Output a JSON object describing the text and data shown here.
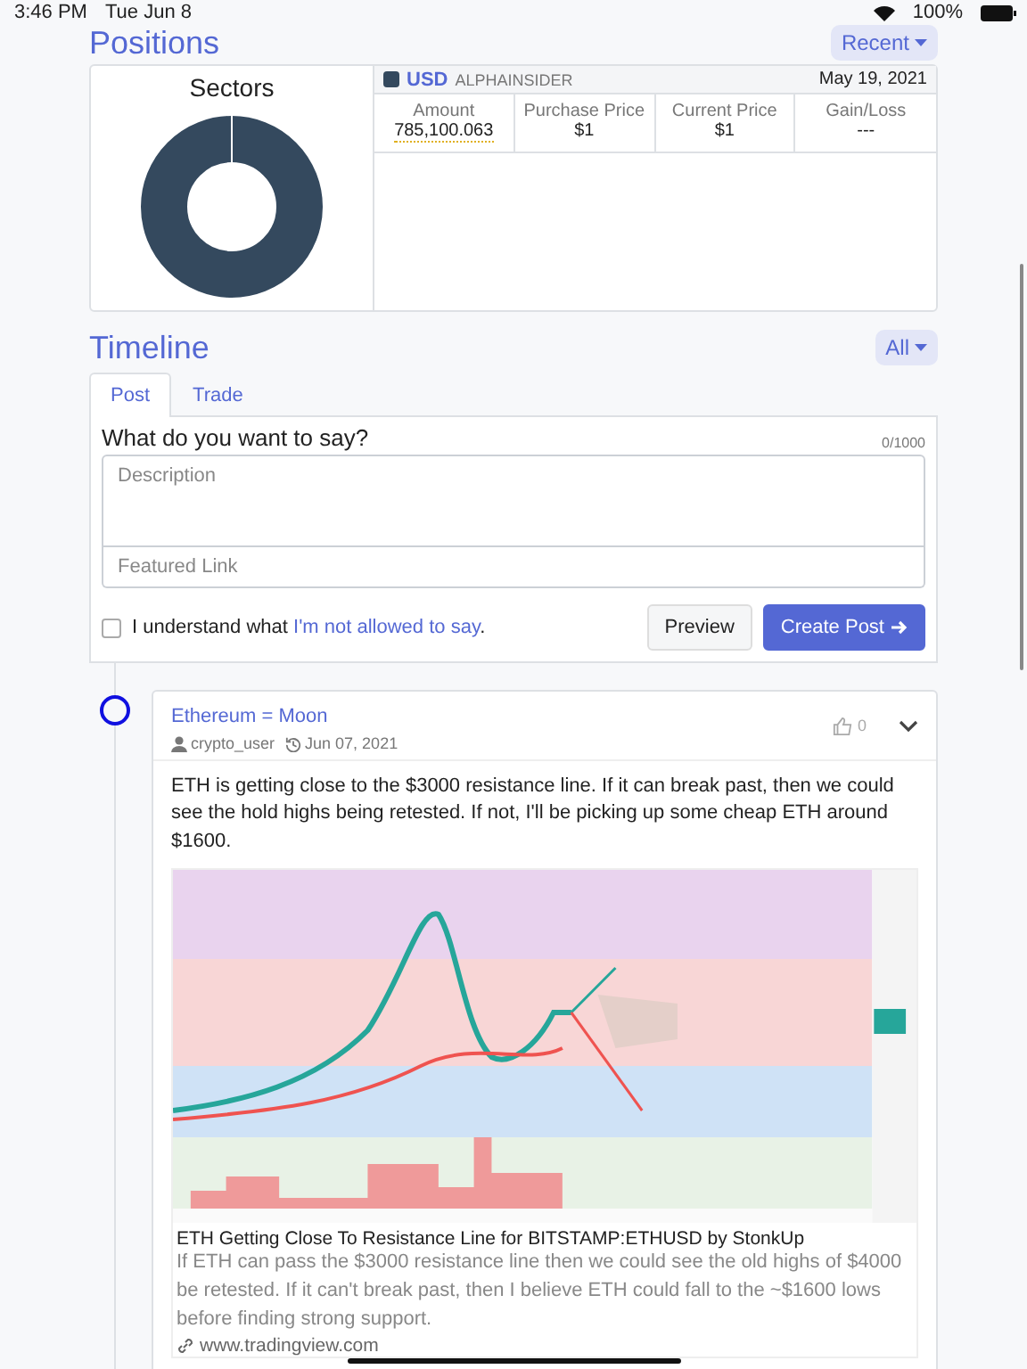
{
  "status_bar": {
    "time": "3:46 PM",
    "date": "Tue Jun 8",
    "battery": "100%"
  },
  "positions": {
    "title": "Positions",
    "filter": "Recent",
    "sectors_title": "Sectors",
    "holding": {
      "symbol": "USD",
      "source": "ALPHAINSIDER",
      "date": "May 19, 2021",
      "color": "#34495e",
      "stats": [
        {
          "label": "Amount",
          "value": "785,100.063",
          "kind": "dotted"
        },
        {
          "label": "Purchase Price",
          "value": "$1",
          "kind": "plain"
        },
        {
          "label": "Current Price",
          "value": "$1",
          "kind": "plain"
        },
        {
          "label": "Gain/Loss",
          "value": "---",
          "kind": "plain"
        }
      ]
    }
  },
  "timeline": {
    "title": "Timeline",
    "filter": "All",
    "tabs": [
      {
        "label": "Post",
        "selected": true
      },
      {
        "label": "Trade",
        "selected": false
      }
    ],
    "composer": {
      "prompt": "What do you want to say?",
      "counter": "0/1000",
      "description": {
        "placeholder": "Description"
      },
      "link": {
        "placeholder": "Featured Link"
      },
      "agree": {
        "checked": false,
        "text": "I understand what ",
        "link": "I'm not allowed to say",
        "after": "."
      },
      "buttons": [
        {
          "label": "Preview",
          "kind": "secondary"
        },
        {
          "label": "Create Post",
          "kind": "primary"
        }
      ]
    },
    "posts": [
      {
        "title": "Ethereum = Moon",
        "author": "crypto_user",
        "date": "Jun 07, 2021",
        "likes": "0",
        "body": "ETH is getting close to the $3000 resistance line. If it can break past, then we could see the hold highs being retested. If not, I'll be picking up some cheap ETH around $1600.",
        "preview": {
          "kind": "picture",
          "title": "ETH Getting Close To Resistance Line for BITSTAMP:ETHUSD by StonkUp",
          "description": "If ETH can pass the $3000 resistance line then we could see the old highs of $4000 be retested. If it can't break past, then I believe ETH could fall to the ~$1600 lows before finding strong support.",
          "url": "www.tradingview.com"
        }
      }
    ]
  }
}
